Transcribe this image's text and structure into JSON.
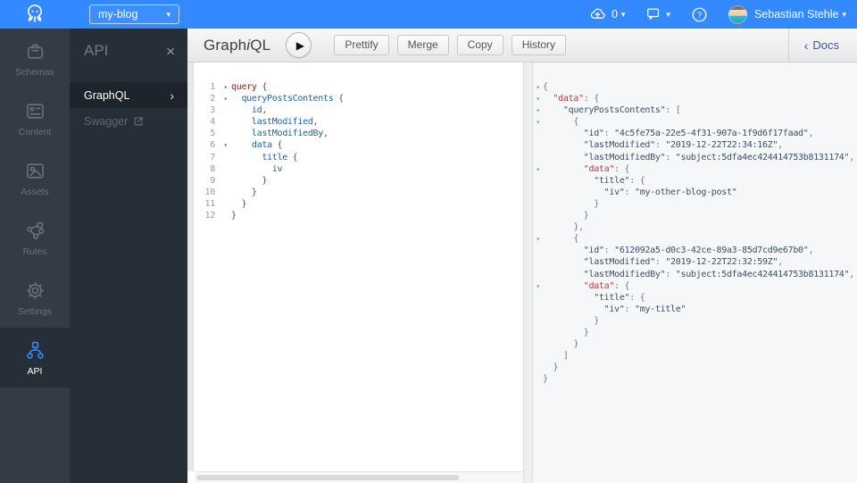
{
  "colors": {
    "accent": "#3389ff",
    "rail_bg": "#333b44",
    "panel_bg": "#262e37",
    "keyword_red": "#b11a04",
    "field_blue": "#1f61a0",
    "json_text": "#3a4f66",
    "json_data_key_red": "#cb3146"
  },
  "glyphs": {
    "caret": "▾",
    "play": "▶",
    "close": "×",
    "chevron_right": "›",
    "docs_chevron": "‹",
    "fold": "▾",
    "help": "?"
  },
  "topbar": {
    "app_name": "my-blog",
    "uploads_count": "0",
    "user_name": "Sebastian Stehle"
  },
  "rail": {
    "items": [
      {
        "label": "Schemas"
      },
      {
        "label": "Content"
      },
      {
        "label": "Assets"
      },
      {
        "label": "Rules"
      },
      {
        "label": "Settings"
      },
      {
        "label": "API"
      }
    ]
  },
  "panel": {
    "title": "API",
    "items": [
      {
        "label": "GraphQL"
      },
      {
        "label": "Swagger"
      }
    ]
  },
  "toolbar": {
    "logo_pre": "Graph",
    "logo_i": "i",
    "logo_post": "QL",
    "buttons": [
      {
        "label": "Prettify"
      },
      {
        "label": "Merge"
      },
      {
        "label": "Copy"
      },
      {
        "label": "History"
      }
    ],
    "docs_label": "Docs"
  },
  "query": {
    "lines": [
      {
        "n": "1",
        "fold": true,
        "seg": [
          [
            "k",
            "query"
          ],
          [
            "p",
            " {"
          ]
        ]
      },
      {
        "n": "2",
        "fold": true,
        "seg": [
          [
            "p",
            "  "
          ],
          [
            "f",
            "queryPostsContents"
          ],
          [
            "p",
            " {"
          ]
        ]
      },
      {
        "n": "3",
        "seg": [
          [
            "p",
            "    "
          ],
          [
            "f",
            "id"
          ],
          [
            "p",
            ","
          ]
        ]
      },
      {
        "n": "4",
        "seg": [
          [
            "p",
            "    "
          ],
          [
            "f",
            "lastModified"
          ],
          [
            "p",
            ","
          ]
        ]
      },
      {
        "n": "5",
        "seg": [
          [
            "p",
            "    "
          ],
          [
            "f",
            "lastModifiedBy"
          ],
          [
            "p",
            ","
          ]
        ]
      },
      {
        "n": "6",
        "fold": true,
        "seg": [
          [
            "p",
            "    "
          ],
          [
            "f",
            "data"
          ],
          [
            "p",
            " {"
          ]
        ]
      },
      {
        "n": "7",
        "seg": [
          [
            "p",
            "      "
          ],
          [
            "f",
            "title"
          ],
          [
            "p",
            " {"
          ]
        ]
      },
      {
        "n": "8",
        "seg": [
          [
            "p",
            "        "
          ],
          [
            "f",
            "iv"
          ]
        ]
      },
      {
        "n": "9",
        "seg": [
          [
            "p",
            "      }"
          ]
        ]
      },
      {
        "n": "10",
        "seg": [
          [
            "p",
            "    }"
          ]
        ]
      },
      {
        "n": "11",
        "seg": [
          [
            "p",
            "  }"
          ]
        ]
      },
      {
        "n": "12",
        "seg": [
          [
            "p",
            "}"
          ]
        ]
      }
    ]
  },
  "result": {
    "lines": [
      {
        "fold": true,
        "seg": [
          [
            "p",
            "{"
          ]
        ]
      },
      {
        "fold": true,
        "seg": [
          [
            "p",
            "  "
          ],
          [
            "rd",
            "\"data\""
          ],
          [
            "p",
            ": {"
          ]
        ]
      },
      {
        "fold": true,
        "seg": [
          [
            "p",
            "    "
          ],
          [
            "rk",
            "\"queryPostsContents\""
          ],
          [
            "p",
            ": ["
          ]
        ]
      },
      {
        "fold": true,
        "seg": [
          [
            "p",
            "      {"
          ]
        ]
      },
      {
        "seg": [
          [
            "p",
            "        "
          ],
          [
            "rk",
            "\"id\""
          ],
          [
            "p",
            ": "
          ],
          [
            "rv",
            "\"4c5fe75a-22e5-4f31-907a-1f9d6f17faad\""
          ],
          [
            "p",
            ","
          ]
        ]
      },
      {
        "seg": [
          [
            "p",
            "        "
          ],
          [
            "rk",
            "\"lastModified\""
          ],
          [
            "p",
            ": "
          ],
          [
            "rv",
            "\"2019-12-22T22:34:16Z\""
          ],
          [
            "p",
            ","
          ]
        ]
      },
      {
        "seg": [
          [
            "p",
            "        "
          ],
          [
            "rk",
            "\"lastModifiedBy\""
          ],
          [
            "p",
            ": "
          ],
          [
            "rv",
            "\"subject:5dfa4ec424414753b8131174\""
          ],
          [
            "p",
            ","
          ]
        ]
      },
      {
        "fold": true,
        "seg": [
          [
            "p",
            "        "
          ],
          [
            "rd",
            "\"data\""
          ],
          [
            "p",
            ": {"
          ]
        ]
      },
      {
        "seg": [
          [
            "p",
            "          "
          ],
          [
            "rk",
            "\"title\""
          ],
          [
            "p",
            ": {"
          ]
        ]
      },
      {
        "seg": [
          [
            "p",
            "            "
          ],
          [
            "rk",
            "\"iv\""
          ],
          [
            "p",
            ": "
          ],
          [
            "rv",
            "\"my-other-blog-post\""
          ]
        ]
      },
      {
        "seg": [
          [
            "p",
            "          }"
          ]
        ]
      },
      {
        "seg": [
          [
            "p",
            "        }"
          ]
        ]
      },
      {
        "seg": [
          [
            "p",
            "      },"
          ]
        ]
      },
      {
        "fold": true,
        "seg": [
          [
            "p",
            "      {"
          ]
        ]
      },
      {
        "seg": [
          [
            "p",
            "        "
          ],
          [
            "rk",
            "\"id\""
          ],
          [
            "p",
            ": "
          ],
          [
            "rv",
            "\"612092a5-d0c3-42ce-89a3-85d7cd9e67b0\""
          ],
          [
            "p",
            ","
          ]
        ]
      },
      {
        "seg": [
          [
            "p",
            "        "
          ],
          [
            "rk",
            "\"lastModified\""
          ],
          [
            "p",
            ": "
          ],
          [
            "rv",
            "\"2019-12-22T22:32:59Z\""
          ],
          [
            "p",
            ","
          ]
        ]
      },
      {
        "seg": [
          [
            "p",
            "        "
          ],
          [
            "rk",
            "\"lastModifiedBy\""
          ],
          [
            "p",
            ": "
          ],
          [
            "rv",
            "\"subject:5dfa4ec424414753b8131174\""
          ],
          [
            "p",
            ","
          ]
        ]
      },
      {
        "fold": true,
        "seg": [
          [
            "p",
            "        "
          ],
          [
            "rd",
            "\"data\""
          ],
          [
            "p",
            ": {"
          ]
        ]
      },
      {
        "seg": [
          [
            "p",
            "          "
          ],
          [
            "rk",
            "\"title\""
          ],
          [
            "p",
            ": {"
          ]
        ]
      },
      {
        "seg": [
          [
            "p",
            "            "
          ],
          [
            "rk",
            "\"iv\""
          ],
          [
            "p",
            ": "
          ],
          [
            "rv",
            "\"my-title\""
          ]
        ]
      },
      {
        "seg": [
          [
            "p",
            "          }"
          ]
        ]
      },
      {
        "seg": [
          [
            "p",
            "        }"
          ]
        ]
      },
      {
        "seg": [
          [
            "p",
            "      }"
          ]
        ]
      },
      {
        "seg": [
          [
            "p",
            "    ]"
          ]
        ]
      },
      {
        "seg": [
          [
            "p",
            "  }"
          ]
        ]
      },
      {
        "seg": [
          [
            "p",
            "}"
          ]
        ]
      }
    ]
  }
}
